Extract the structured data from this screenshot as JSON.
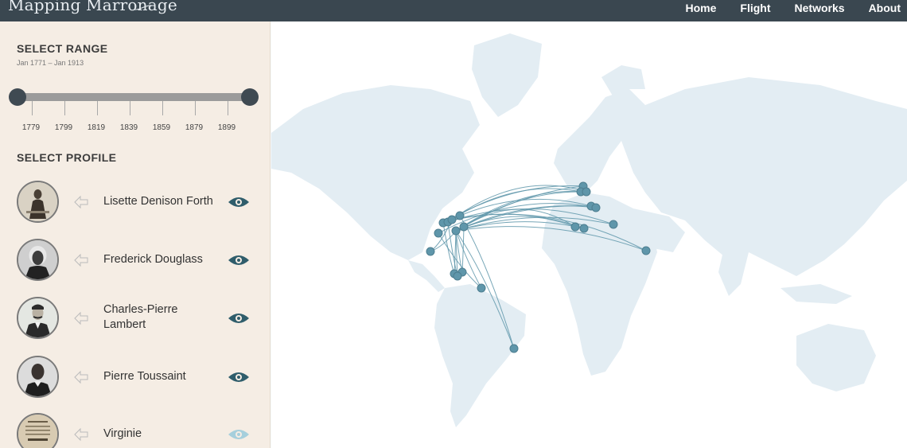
{
  "header": {
    "logo": "Mapping Marronage",
    "nav": [
      "Home",
      "Flight",
      "Networks",
      "About"
    ]
  },
  "sidebar": {
    "range_title": "SELECT RANGE",
    "range_value": "Jan 1771 – Jan 1913",
    "range_ticks": [
      "1779",
      "1799",
      "1819",
      "1839",
      "1859",
      "1879",
      "1899"
    ],
    "profile_title": "SELECT PROFILE",
    "profiles": [
      {
        "name": "Lisette Denison Forth",
        "visible": true
      },
      {
        "name": "Frederick Douglass",
        "visible": true
      },
      {
        "name": "Charles-Pierre Lambert",
        "visible": true
      },
      {
        "name": "Pierre Toussaint",
        "visible": true
      },
      {
        "name": "Virginie",
        "visible": false
      }
    ]
  },
  "colors": {
    "topbar": "#3a4750",
    "sidebar": "#f5ede4",
    "land": "#e3edf3",
    "route": "#5f96aa",
    "eye_on": "#2f5d6b",
    "eye_off": "#a6cfdc"
  }
}
